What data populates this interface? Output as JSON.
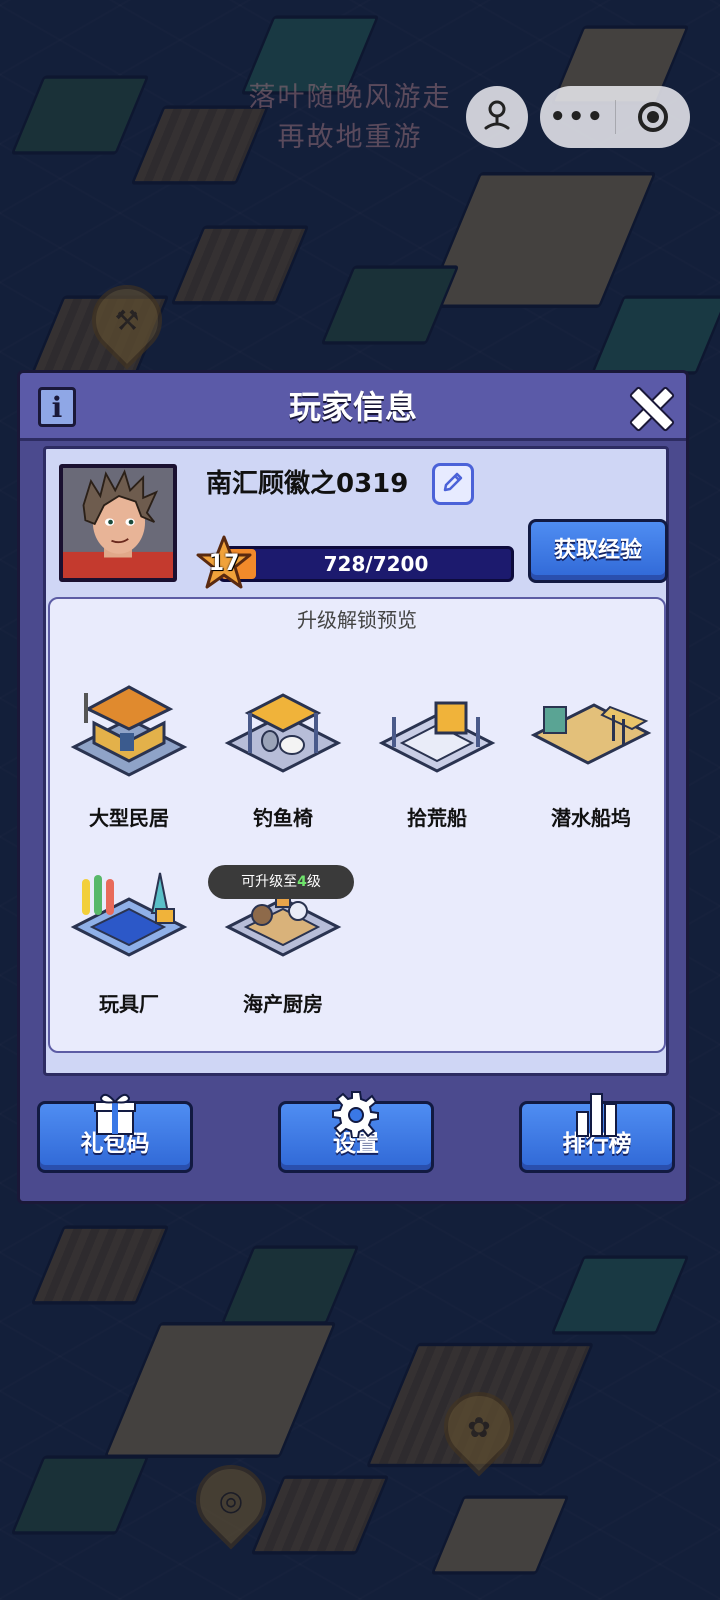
{
  "watermark": {
    "line1": "落叶随晚风游走",
    "line2": "再故地重游"
  },
  "capsule": {
    "more_icon": "more-dots-icon",
    "close_icon": "record-icon",
    "profile_icon": "person-icon"
  },
  "modal": {
    "title": "玩家信息",
    "info_label": "i",
    "player": {
      "name": "南汇顾徽之0319",
      "level": "17",
      "xp_text": "728/7200",
      "xp_progress": 0.1011
    },
    "get_xp_label": "获取经验",
    "preview": {
      "title": "升级解锁预览",
      "items": [
        {
          "label": "大型民居"
        },
        {
          "label": "钓鱼椅"
        },
        {
          "label": "拾荒船"
        },
        {
          "label": "潜水船坞"
        },
        {
          "label": "玩具厂"
        },
        {
          "label": "海产厨房"
        }
      ],
      "tooltip": {
        "prefix": "可升级至",
        "level": "4",
        "suffix": "级"
      }
    },
    "footer": {
      "gift_label": "礼包码",
      "settings_label": "设置",
      "ranking_label": "排行榜"
    }
  },
  "colors": {
    "accent": "#3a78e6",
    "panel": "#4b4a8e",
    "xp_fill": "#f28a2a"
  }
}
